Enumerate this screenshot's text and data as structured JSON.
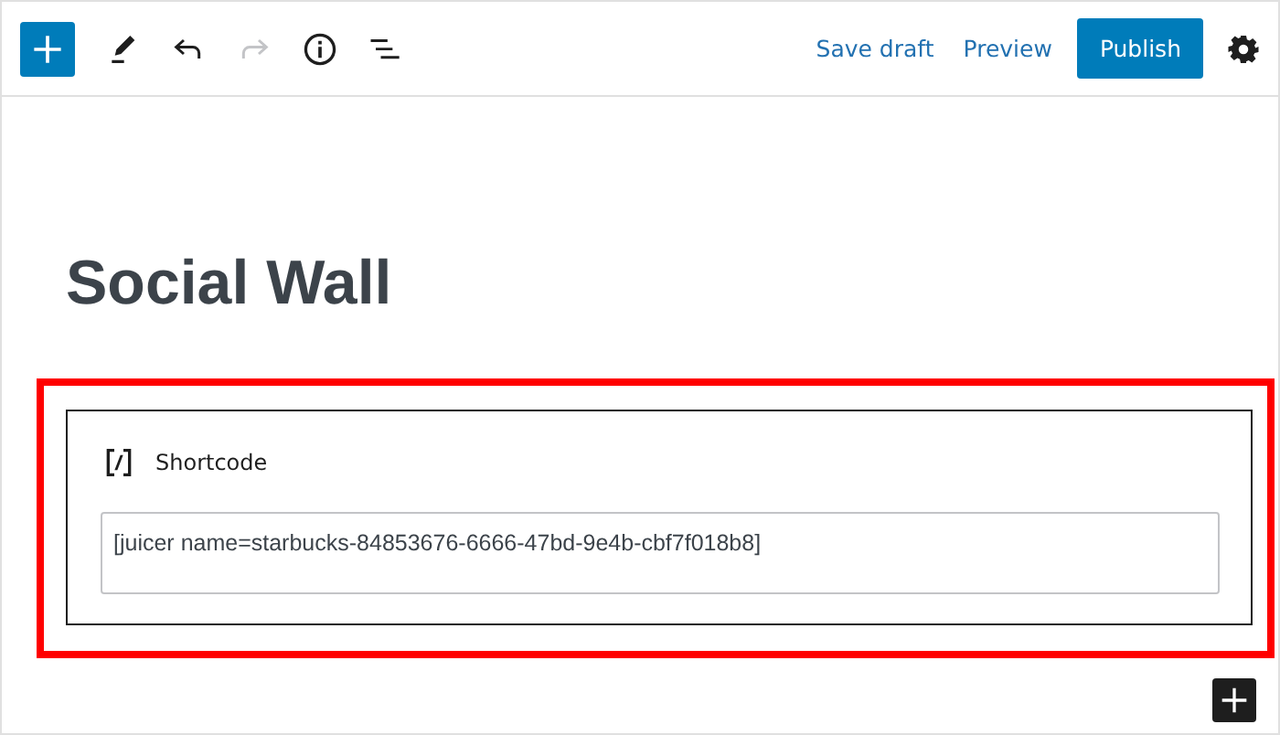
{
  "toolbar": {
    "tools": [
      {
        "kind": "inserter",
        "disabled": false
      },
      {
        "kind": "edit",
        "disabled": false
      },
      {
        "kind": "undo",
        "disabled": false
      },
      {
        "kind": "redo",
        "disabled": true
      },
      {
        "kind": "info",
        "disabled": false
      },
      {
        "kind": "outline",
        "disabled": false
      }
    ],
    "save_draft": "Save draft",
    "preview": "Preview",
    "publish": "Publish"
  },
  "post_title": "Social Wall",
  "block": {
    "title": "Shortcode",
    "value": "[juicer name=starbucks-84853676-6666-47bd-9e4b-cbf7f018b8]",
    "highlighted": true
  }
}
